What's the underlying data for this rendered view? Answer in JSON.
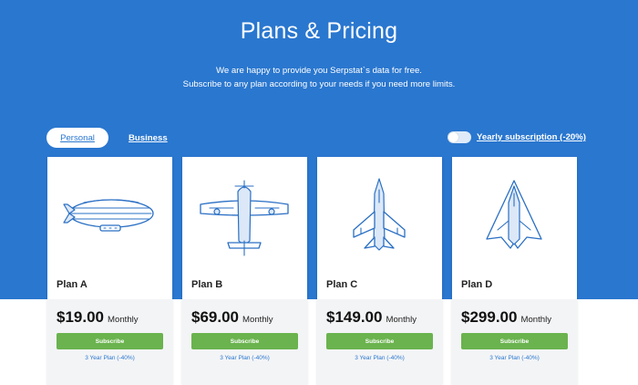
{
  "header": {
    "title": "Plans & Pricing",
    "subtitle_line1": "We are happy to provide you Serpstat`s data for free.",
    "subtitle_line2": "Subscribe to any plan according to your needs if you need more limits."
  },
  "tabs": [
    {
      "label": "Personal",
      "active": true
    },
    {
      "label": "Business",
      "active": false
    }
  ],
  "billing_toggle": {
    "label": "Yearly subscription (-20%)",
    "enabled": false
  },
  "plans": [
    {
      "name": "Plan A",
      "price": "$19.00",
      "period": "Monthly",
      "button": "Subscribe",
      "link": "3 Year Plan (-40%)",
      "icon": "airship-icon"
    },
    {
      "name": "Plan B",
      "price": "$69.00",
      "period": "Monthly",
      "button": "Subscribe",
      "link": "3 Year Plan (-40%)",
      "icon": "propeller-plane-icon"
    },
    {
      "name": "Plan C",
      "price": "$149.00",
      "period": "Monthly",
      "button": "Subscribe",
      "link": "3 Year Plan (-40%)",
      "icon": "jet-fighter-icon"
    },
    {
      "name": "Plan D",
      "price": "$299.00",
      "period": "Monthly",
      "button": "Subscribe",
      "link": "3 Year Plan (-40%)",
      "icon": "stealth-jet-icon"
    }
  ],
  "colors": {
    "hero_background": "#2a77cf",
    "subscribe_button": "#6ab34e",
    "link": "#2a77cf",
    "price_area": "#f3f4f6"
  }
}
